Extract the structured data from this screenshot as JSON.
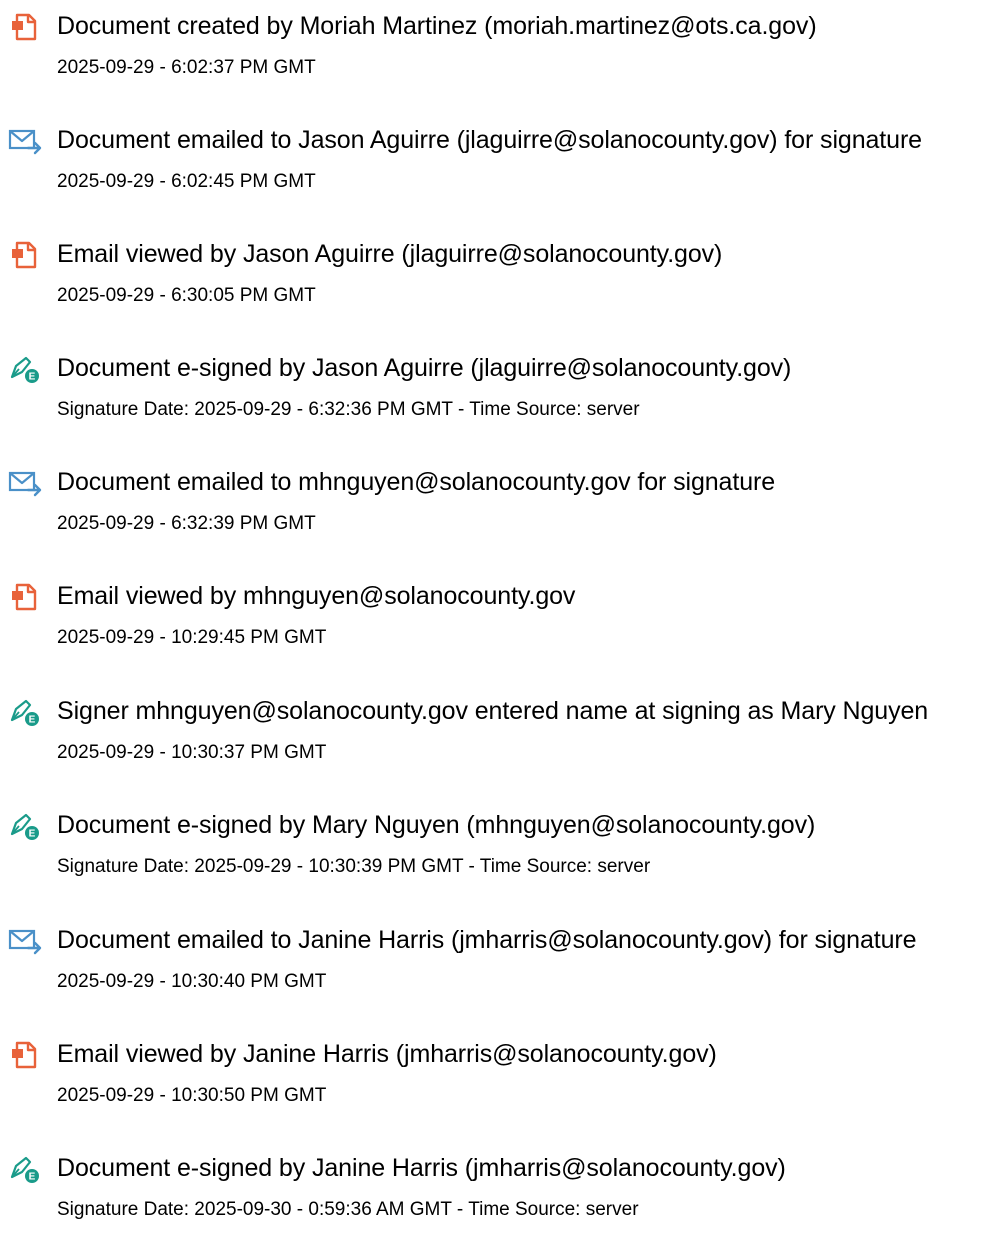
{
  "colors": {
    "text": "#000000",
    "doc_icon": "#e8623a",
    "mail_icon": "#4a90c8",
    "sign_icon": "#1a9b8a"
  },
  "events": [
    {
      "icon": "document-icon",
      "title": "Document created by Moriah Martinez (moriah.martinez@ots.ca.gov)",
      "detail": "2025-09-29 - 6:02:37 PM GMT"
    },
    {
      "icon": "email-icon",
      "title": "Document emailed to Jason Aguirre (jlaguirre@solanocounty.gov) for signature",
      "detail": "2025-09-29 - 6:02:45 PM GMT"
    },
    {
      "icon": "document-icon",
      "title": "Email viewed by Jason Aguirre (jlaguirre@solanocounty.gov)",
      "detail": "2025-09-29 - 6:30:05 PM GMT"
    },
    {
      "icon": "e-sign-icon",
      "title": "Document e-signed by Jason Aguirre (jlaguirre@solanocounty.gov)",
      "detail": "Signature Date: 2025-09-29 - 6:32:36 PM GMT - Time Source: server"
    },
    {
      "icon": "email-icon",
      "title": "Document emailed to mhnguyen@solanocounty.gov for signature",
      "detail": "2025-09-29 - 6:32:39 PM GMT"
    },
    {
      "icon": "document-icon",
      "title": "Email viewed by mhnguyen@solanocounty.gov",
      "detail": "2025-09-29 - 10:29:45 PM GMT"
    },
    {
      "icon": "e-sign-icon",
      "title": "Signer mhnguyen@solanocounty.gov entered name at signing as Mary Nguyen",
      "detail": "2025-09-29 - 10:30:37 PM GMT"
    },
    {
      "icon": "e-sign-icon",
      "title": "Document e-signed by Mary Nguyen (mhnguyen@solanocounty.gov)",
      "detail": "Signature Date: 2025-09-29 - 10:30:39 PM GMT - Time Source: server"
    },
    {
      "icon": "email-icon",
      "title": "Document emailed to Janine Harris (jmharris@solanocounty.gov) for signature",
      "detail": "2025-09-29 - 10:30:40 PM GMT"
    },
    {
      "icon": "document-icon",
      "title": "Email viewed by Janine Harris (jmharris@solanocounty.gov)",
      "detail": "2025-09-29 - 10:30:50 PM GMT"
    },
    {
      "icon": "e-sign-icon",
      "title": "Document e-signed by Janine Harris (jmharris@solanocounty.gov)",
      "detail": "Signature Date: 2025-09-30 - 0:59:36 AM GMT - Time Source: server"
    }
  ]
}
